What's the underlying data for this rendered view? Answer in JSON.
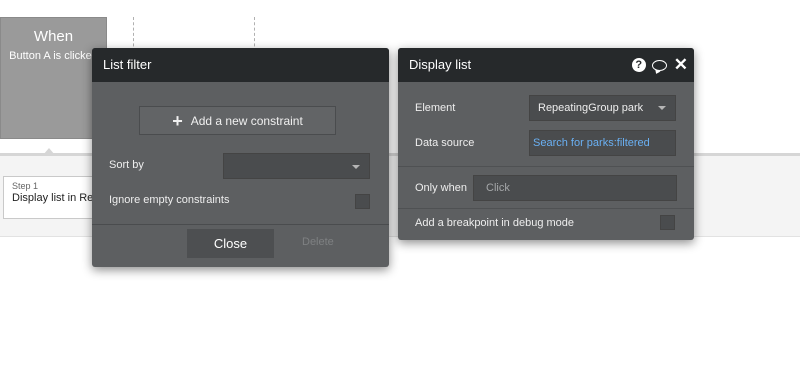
{
  "workflow": {
    "event_title": "When",
    "event_subtitle": "Button A is clicked",
    "step_number": "Step 1",
    "step_label": "Display list in Re"
  },
  "list_filter": {
    "title": "List filter",
    "add_constraint_label": "Add a new constraint",
    "sort_by_label": "Sort by",
    "sort_by_value": "",
    "ignore_empty_label": "Ignore empty constraints",
    "ignore_empty_checked": false,
    "close_label": "Close",
    "delete_label": "Delete"
  },
  "display_list": {
    "title": "Display list",
    "element_label": "Element",
    "element_value": "RepeatingGroup park",
    "data_source_label": "Data source",
    "data_source_value": "Search for parks:filtered",
    "only_when_label": "Only when",
    "only_when_placeholder": "Click",
    "breakpoint_label": "Add a breakpoint in debug mode",
    "breakpoint_checked": false,
    "icons": [
      "help-icon",
      "comment-icon",
      "close-icon"
    ]
  },
  "colors": {
    "panel_header": "#26292b",
    "panel_body": "#5d5f61",
    "field_bg": "#4a4c4e",
    "link_blue": "#6ab0f3",
    "event_card": "#9a9a9a"
  }
}
